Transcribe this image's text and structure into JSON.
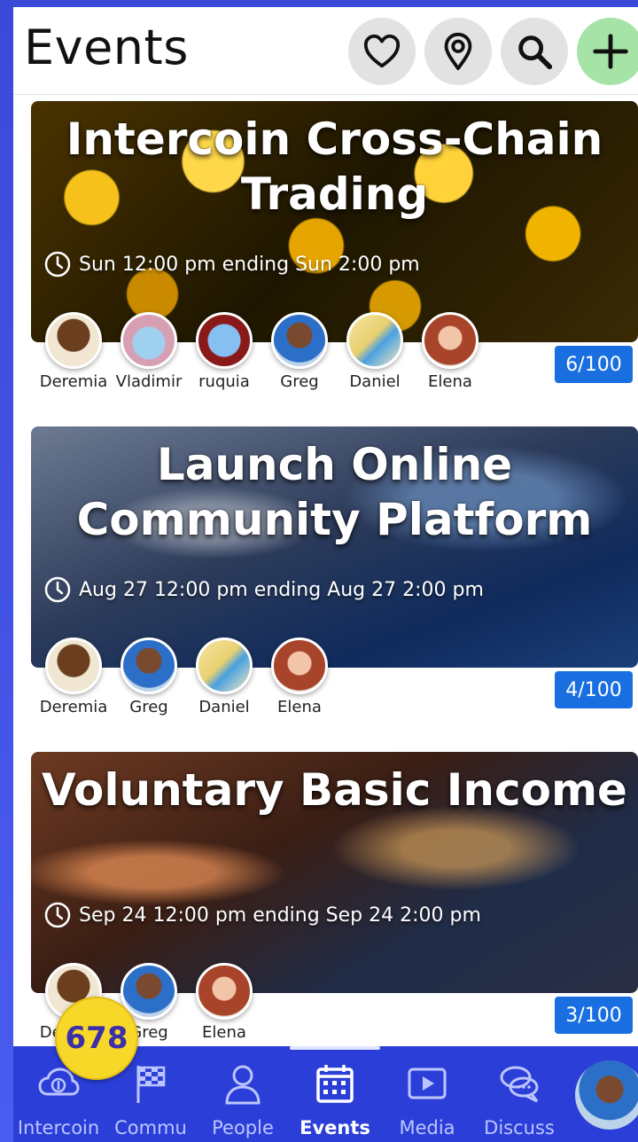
{
  "header": {
    "title": "Events",
    "buttons": [
      {
        "icon": "heart-icon"
      },
      {
        "icon": "location-pin-icon"
      },
      {
        "icon": "search-icon"
      },
      {
        "icon": "plus-icon"
      }
    ]
  },
  "events": [
    {
      "title": "Intercoin Cross-Chain Trading",
      "time": "Sun 12:00 pm ending Sun 2:00 pm",
      "count": "6/100",
      "attendees": [
        "Deremia",
        "Vladimir",
        "ruquia",
        "Greg",
        "Daniel",
        "Elena"
      ]
    },
    {
      "title": "Launch Online Community Platform",
      "time": "Aug 27 12:00 pm ending Aug 27 2:00 pm",
      "count": "4/100",
      "attendees": [
        "Deremia",
        "Greg",
        "Daniel",
        "Elena"
      ]
    },
    {
      "title": "Voluntary Basic Income",
      "time": "Sep 24 12:00 pm ending Sep 24 2:00 pm",
      "count": "3/100",
      "attendees": [
        "Deremia",
        "Greg",
        "Elena"
      ]
    }
  ],
  "badge": "678",
  "nav": [
    {
      "label": "Intercoin",
      "icon": "cloud-coin-icon",
      "active": false
    },
    {
      "label": "Commu",
      "icon": "checkered-flag-icon",
      "active": false
    },
    {
      "label": "People",
      "icon": "person-icon",
      "active": false
    },
    {
      "label": "Events",
      "icon": "calendar-icon",
      "active": true
    },
    {
      "label": "Media",
      "icon": "play-icon",
      "active": false
    },
    {
      "label": "Discuss",
      "icon": "chat-bubbles-icon",
      "active": false
    }
  ],
  "colors": {
    "accent": "#1a6fe0",
    "nav_bg": "#2b3fd8",
    "badge": "#f7d728",
    "add_button": "#a6e3a6"
  }
}
